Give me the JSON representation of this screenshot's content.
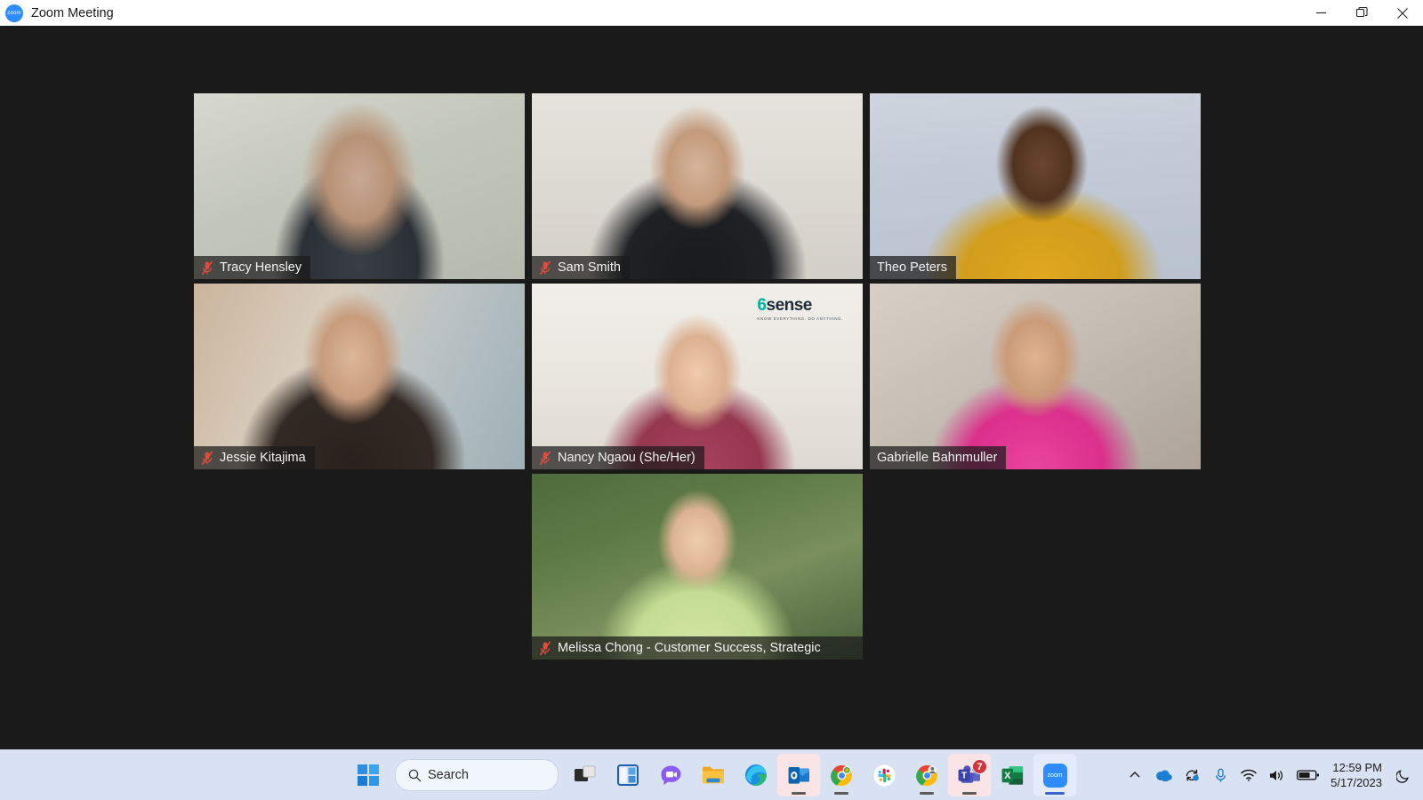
{
  "window": {
    "title": "Zoom Meeting",
    "logo_text": "zoom",
    "controls": {
      "minimize": "minimize-button",
      "restore": "restore-button",
      "close": "close-button"
    }
  },
  "meeting": {
    "layout": "gallery",
    "participant_count": 7,
    "participants": [
      {
        "name": "Tracy Hensley",
        "muted": true,
        "row": 1,
        "col": 1
      },
      {
        "name": "Sam Smith",
        "muted": true,
        "row": 1,
        "col": 2
      },
      {
        "name": "Theo Peters",
        "muted": false,
        "row": 1,
        "col": 3
      },
      {
        "name": "Jessie Kitajima",
        "muted": true,
        "row": 2,
        "col": 1
      },
      {
        "name": "Nancy Ngaou (She/Her)",
        "muted": true,
        "row": 2,
        "col": 2
      },
      {
        "name": "Gabrielle Bahnmuller",
        "muted": false,
        "row": 2,
        "col": 3
      },
      {
        "name": "Melissa Chong - Customer Success, Strategic",
        "muted": true,
        "row": 3,
        "col": 2
      }
    ],
    "background_logo": {
      "text": "sense",
      "mark": "6",
      "tagline": "KNOW EVERYTHING. DO ANYTHING."
    }
  },
  "taskbar": {
    "search_placeholder": "Search",
    "items": [
      {
        "name": "start-button",
        "label": "Start"
      },
      {
        "name": "search-button",
        "label": "Search"
      },
      {
        "name": "task-view-button",
        "label": "Task View"
      },
      {
        "name": "widgets-button",
        "label": "Widgets"
      },
      {
        "name": "teams-chat-button",
        "label": "Chat"
      },
      {
        "name": "file-explorer-button",
        "label": "File Explorer"
      },
      {
        "name": "edge-button",
        "label": "Microsoft Edge"
      },
      {
        "name": "outlook-button",
        "label": "Outlook"
      },
      {
        "name": "chrome-button",
        "label": "Google Chrome"
      },
      {
        "name": "slack-button",
        "label": "Slack"
      },
      {
        "name": "chrome-profile-button",
        "label": "Google Chrome"
      },
      {
        "name": "teams-button",
        "label": "Microsoft Teams",
        "badge": "7"
      },
      {
        "name": "excel-button",
        "label": "Excel"
      },
      {
        "name": "zoom-button",
        "label": "Zoom",
        "logo_text": "zoom"
      }
    ],
    "tray": [
      {
        "name": "show-hidden-icons-button",
        "label": "Show hidden icons"
      },
      {
        "name": "onedrive-icon",
        "label": "OneDrive"
      },
      {
        "name": "sync-icon",
        "label": "Sync"
      },
      {
        "name": "microphone-icon",
        "label": "Microphone in use"
      },
      {
        "name": "wifi-icon",
        "label": "Network"
      },
      {
        "name": "volume-icon",
        "label": "Volume"
      },
      {
        "name": "battery-icon",
        "label": "Battery"
      }
    ],
    "clock": {
      "time": "12:59 PM",
      "date": "5/17/2023"
    },
    "notifications": {
      "name": "do-not-disturb-icon",
      "label": "Notifications"
    }
  },
  "colors": {
    "zoom_blue": "#2d8cff",
    "taskbar": "#d9e2f3",
    "stage_background": "#1a1a1a",
    "mute_red": "#e24a3d",
    "badge_red": "#d13438"
  }
}
